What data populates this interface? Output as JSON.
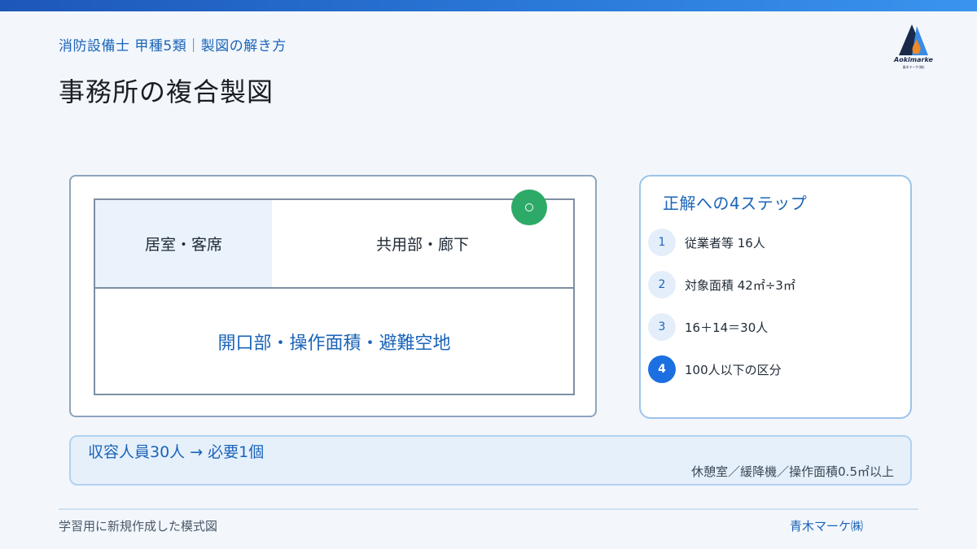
{
  "header": {
    "subtitle": "消防設備士 甲種5類｜製図の解き方",
    "title": "事務所の複合製図",
    "logo_text": "Aokimarke",
    "logo_sub": "青木マーケ(株)"
  },
  "plan": {
    "rooms": {
      "living": "居室・客席",
      "common": "共用部・廊下",
      "open": "開口部・操作面積・避難空地"
    },
    "marker_symbol": "extinguisher-circle-icon"
  },
  "steps": {
    "title": "正解への4ステップ",
    "items": [
      {
        "num": "1",
        "text": "従業者等 16人"
      },
      {
        "num": "2",
        "text": "対象面積 42㎡÷3㎡"
      },
      {
        "num": "3",
        "text": "16＋14＝30人"
      },
      {
        "num": "4",
        "text": "100人以下の区分"
      }
    ]
  },
  "note": {
    "main": "収容人員30人 → 必要1個",
    "sub": "休憩室／緩降機／操作面積0.5㎡以上"
  },
  "footer": {
    "left": "学習用に新規作成した模式図",
    "right": "青木マーケ㈱"
  },
  "colors": {
    "accent": "#1b64b8",
    "step_active": "#1c6fe0",
    "marker": "#2eaa68"
  }
}
